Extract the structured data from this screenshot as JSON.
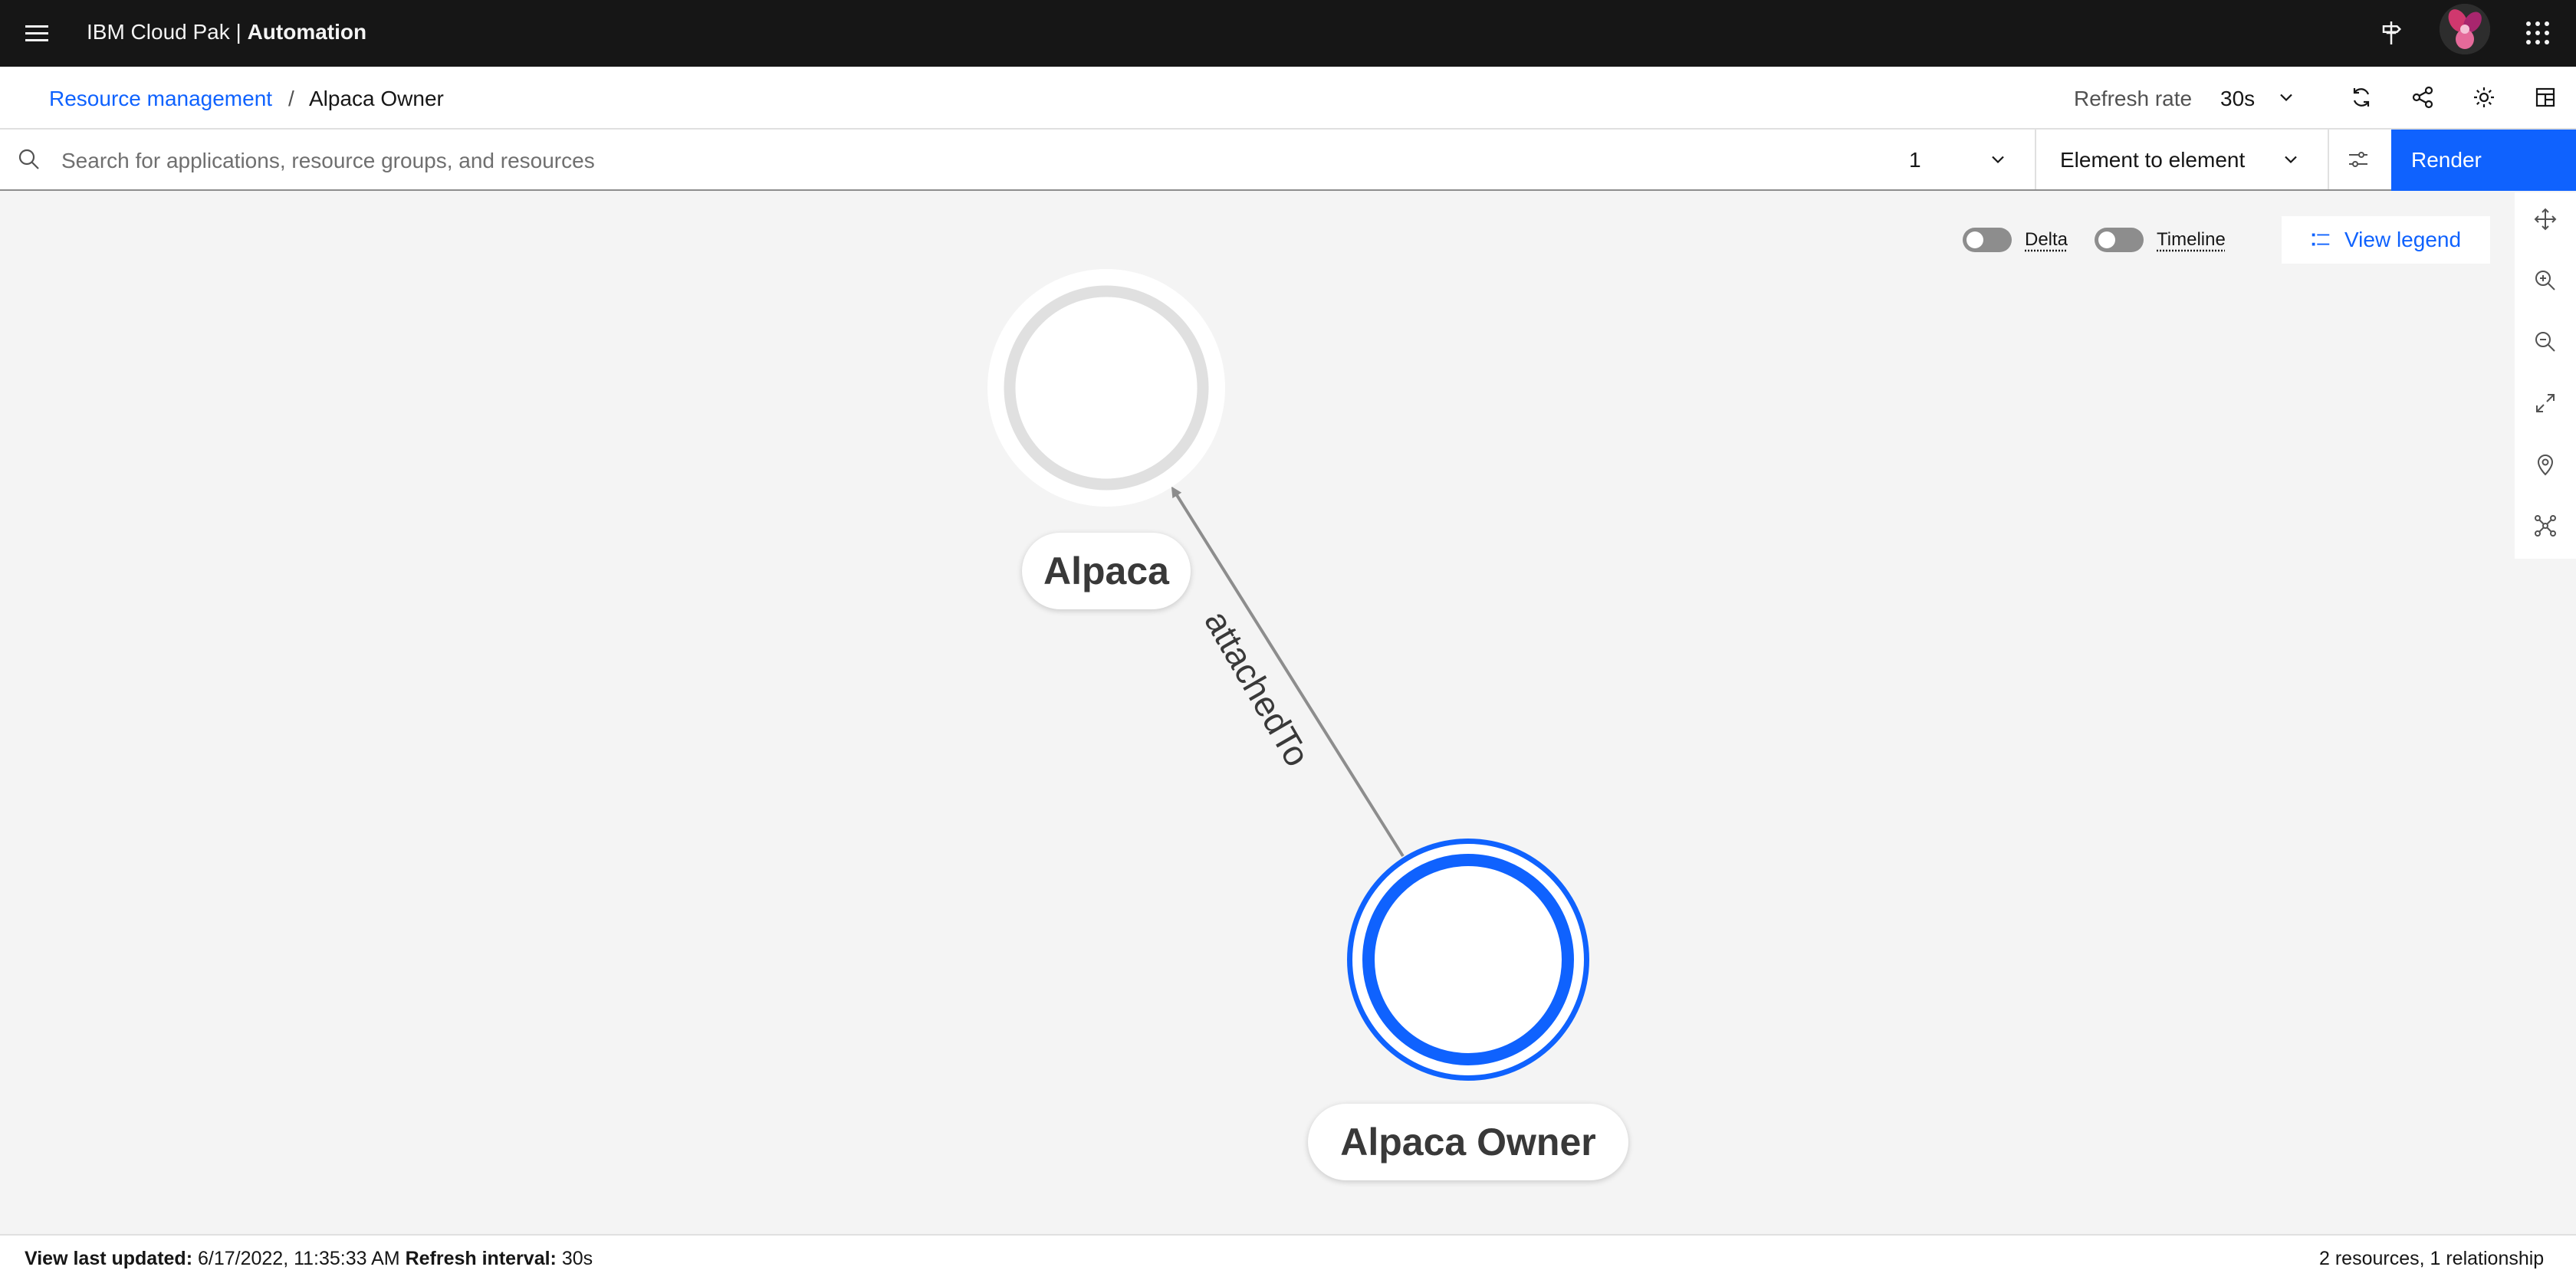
{
  "header": {
    "brand_prefix": "IBM Cloud Pak |",
    "brand_product": "Automation"
  },
  "breadcrumb": {
    "parent": "Resource management",
    "separator": "/",
    "current": "Alpaca Owner"
  },
  "refresh": {
    "label": "Refresh rate",
    "value": "30s"
  },
  "search": {
    "placeholder": "Search for applications, resource groups, and resources",
    "value": "",
    "hop_count": "1",
    "hop_type": "Element to element",
    "render_label": "Render"
  },
  "canvas": {
    "toggles": [
      {
        "label": "Delta",
        "on": false
      },
      {
        "label": "Timeline",
        "on": false
      }
    ],
    "legend_label": "View legend",
    "nodes": [
      {
        "label": "Alpaca",
        "selected": false
      },
      {
        "label": "Alpaca Owner",
        "selected": true
      }
    ],
    "edge": {
      "label": "attachedTo",
      "from": "Alpaca Owner",
      "to": "Alpaca"
    }
  },
  "footer": {
    "updated_label": "View last updated:",
    "updated_value": "6/17/2022, 11:35:33 AM",
    "interval_label": "Refresh interval:",
    "interval_value": "30s",
    "summary": "2 resources, 1 relationship"
  },
  "colors": {
    "accent": "#0f62fe",
    "header_bg": "#161616",
    "canvas_bg": "#f4f4f4",
    "node_ring": "#e0e0e0",
    "edge": "#8d8d8d"
  },
  "icons": [
    "menu-icon",
    "signpost-icon",
    "app-switcher-icon",
    "refresh-icon",
    "share-icon",
    "settings-icon",
    "layout-icon",
    "search-icon",
    "chevron-down-icon",
    "filter-settings-icon",
    "legend-list-icon",
    "pan-icon",
    "zoom-in-icon",
    "zoom-out-icon",
    "fit-to-screen-icon",
    "location-icon",
    "topology-icon"
  ]
}
